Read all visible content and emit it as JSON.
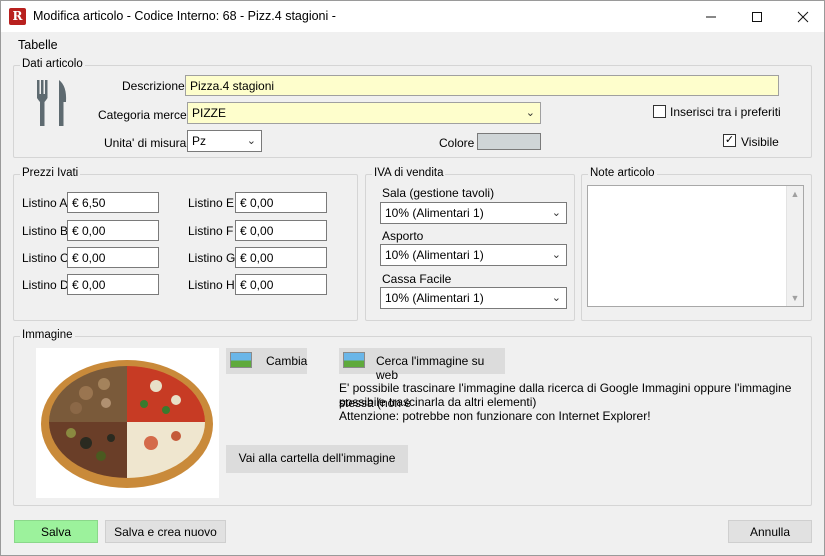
{
  "window": {
    "title": "Modifica articolo - Codice Interno: 68 - Pizz.4 stagioni -",
    "app_icon_text": "R"
  },
  "menu": {
    "items": [
      "Tabelle"
    ]
  },
  "dati_articolo": {
    "legend": "Dati articolo",
    "descrizione_label": "Descrizione",
    "descrizione_value": "Pizza.4 stagioni",
    "categoria_label": "Categoria merce",
    "categoria_value": "PIZZE",
    "unita_label": "Unita' di misura",
    "unita_value": "Pz",
    "colore_label": "Colore",
    "colore_value": "#cfd5d7",
    "preferiti_label": "Inserisci tra i preferiti",
    "preferiti_checked": false,
    "visibile_label": "Visibile",
    "visibile_checked": true
  },
  "prezzi": {
    "legend": "Prezzi Ivati",
    "listini": [
      {
        "label": "Listino A",
        "value": "€ 6,50"
      },
      {
        "label": "Listino B",
        "value": "€ 0,00"
      },
      {
        "label": "Listino C",
        "value": "€ 0,00"
      },
      {
        "label": "Listino D",
        "value": "€ 0,00"
      },
      {
        "label": "Listino E",
        "value": "€ 0,00"
      },
      {
        "label": "Listino F",
        "value": "€ 0,00"
      },
      {
        "label": "Listino G",
        "value": "€ 0,00"
      },
      {
        "label": "Listino H",
        "value": "€ 0,00"
      }
    ]
  },
  "iva": {
    "legend": "IVA di vendita",
    "sala_label": "Sala (gestione tavoli)",
    "sala_value": "10% (Alimentari 1)",
    "asporto_label": "Asporto",
    "asporto_value": "10% (Alimentari 1)",
    "cassa_label": "Cassa Facile",
    "cassa_value": "10% (Alimentari 1)"
  },
  "note": {
    "legend": "Note articolo",
    "value": ""
  },
  "immagine": {
    "legend": "Immagine",
    "cambia_label": "Cambia",
    "cerca_label": "Cerca l'immagine su web",
    "info_line1": "E' possibile trascinare l'immagine dalla ricerca di Google Immagini oppure l'immagine stessa (non è",
    "info_line2": "possibile trascinarla da altri elementi)",
    "info_line3": "Attenzione: potrebbe non funzionare con Internet Explorer!",
    "cartella_label": "Vai alla cartella dell'immagine"
  },
  "footer": {
    "salva_label": "Salva",
    "salva_nuovo_label": "Salva e crea nuovo",
    "annulla_label": "Annulla"
  }
}
